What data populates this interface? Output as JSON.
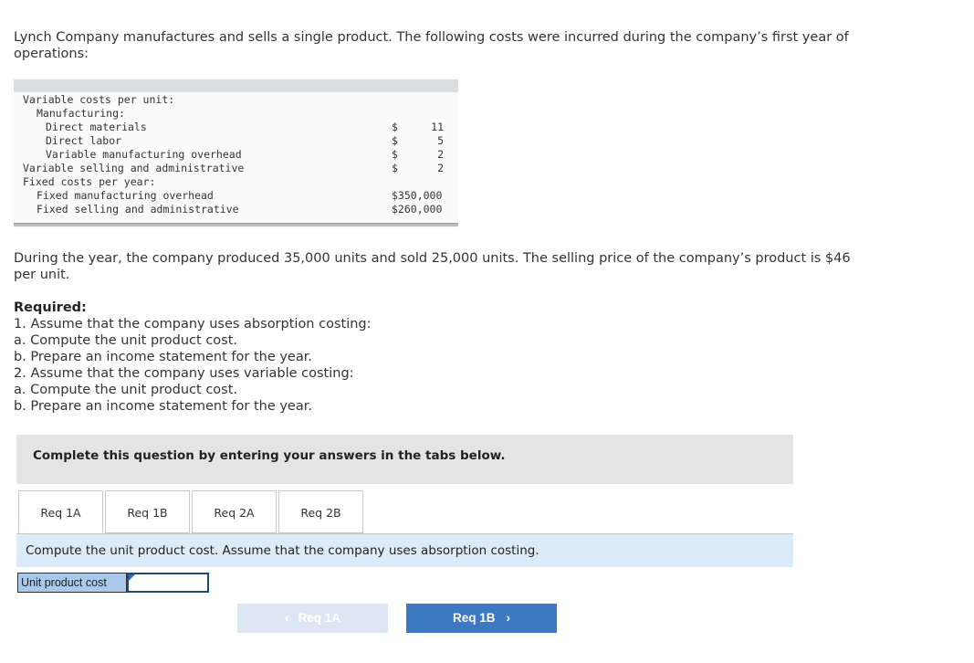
{
  "intro": "Lynch Company manufactures and sells a single product. The following costs were incurred during the company’s first year of operations:",
  "cost_table": {
    "rows": [
      {
        "label": "Variable costs per unit:",
        "currency": "",
        "value": ""
      },
      {
        "label": "Manufacturing:",
        "currency": "",
        "value": ""
      },
      {
        "label": "Direct materials",
        "currency": "$",
        "value": "11"
      },
      {
        "label": "Direct labor",
        "currency": "$",
        "value": "5"
      },
      {
        "label": "Variable manufacturing overhead",
        "currency": "$",
        "value": "2"
      },
      {
        "label": "Variable selling and administrative",
        "currency": "$",
        "value": "2"
      },
      {
        "label": "Fixed costs per year:",
        "currency": "",
        "value": ""
      },
      {
        "label": "Fixed manufacturing overhead",
        "currency": "",
        "value": "$350,000"
      },
      {
        "label": "Fixed selling and administrative",
        "currency": "",
        "value": "$260,000"
      }
    ]
  },
  "during": "During the year, the company produced 35,000 units and sold 25,000 units. The selling price of the company’s product is $46 per unit.",
  "required": {
    "title": "Required:",
    "lines": [
      "1. Assume that the company uses absorption costing:",
      "a. Compute the unit product cost.",
      "b. Prepare an income statement for the year.",
      "2. Assume that the company uses variable costing:",
      "a. Compute the unit product cost.",
      "b. Prepare an income statement for the year."
    ]
  },
  "banner": "Complete this question by entering your answers in the tabs below.",
  "tabs": [
    {
      "label": "Req 1A",
      "active": true
    },
    {
      "label": "Req 1B",
      "active": false
    },
    {
      "label": "Req 2A",
      "active": false
    },
    {
      "label": "Req 2B",
      "active": false
    }
  ],
  "instruction": "Compute the unit product cost. Assume that the company uses absorption costing.",
  "answer": {
    "label": "Unit product cost",
    "value": ""
  },
  "nav": {
    "prev_label": "Req 1A",
    "next_label": "Req 1B",
    "prev_icon": "chevron-left-icon",
    "next_icon": "chevron-right-icon"
  },
  "colors": {
    "banner_bg": "#e4e4e4",
    "instruction_bg": "#dcebf7",
    "answer_label_bg": "#a9c8ea",
    "next_button": "#3c79c2",
    "prev_button_disabled": "#dde7f3"
  }
}
